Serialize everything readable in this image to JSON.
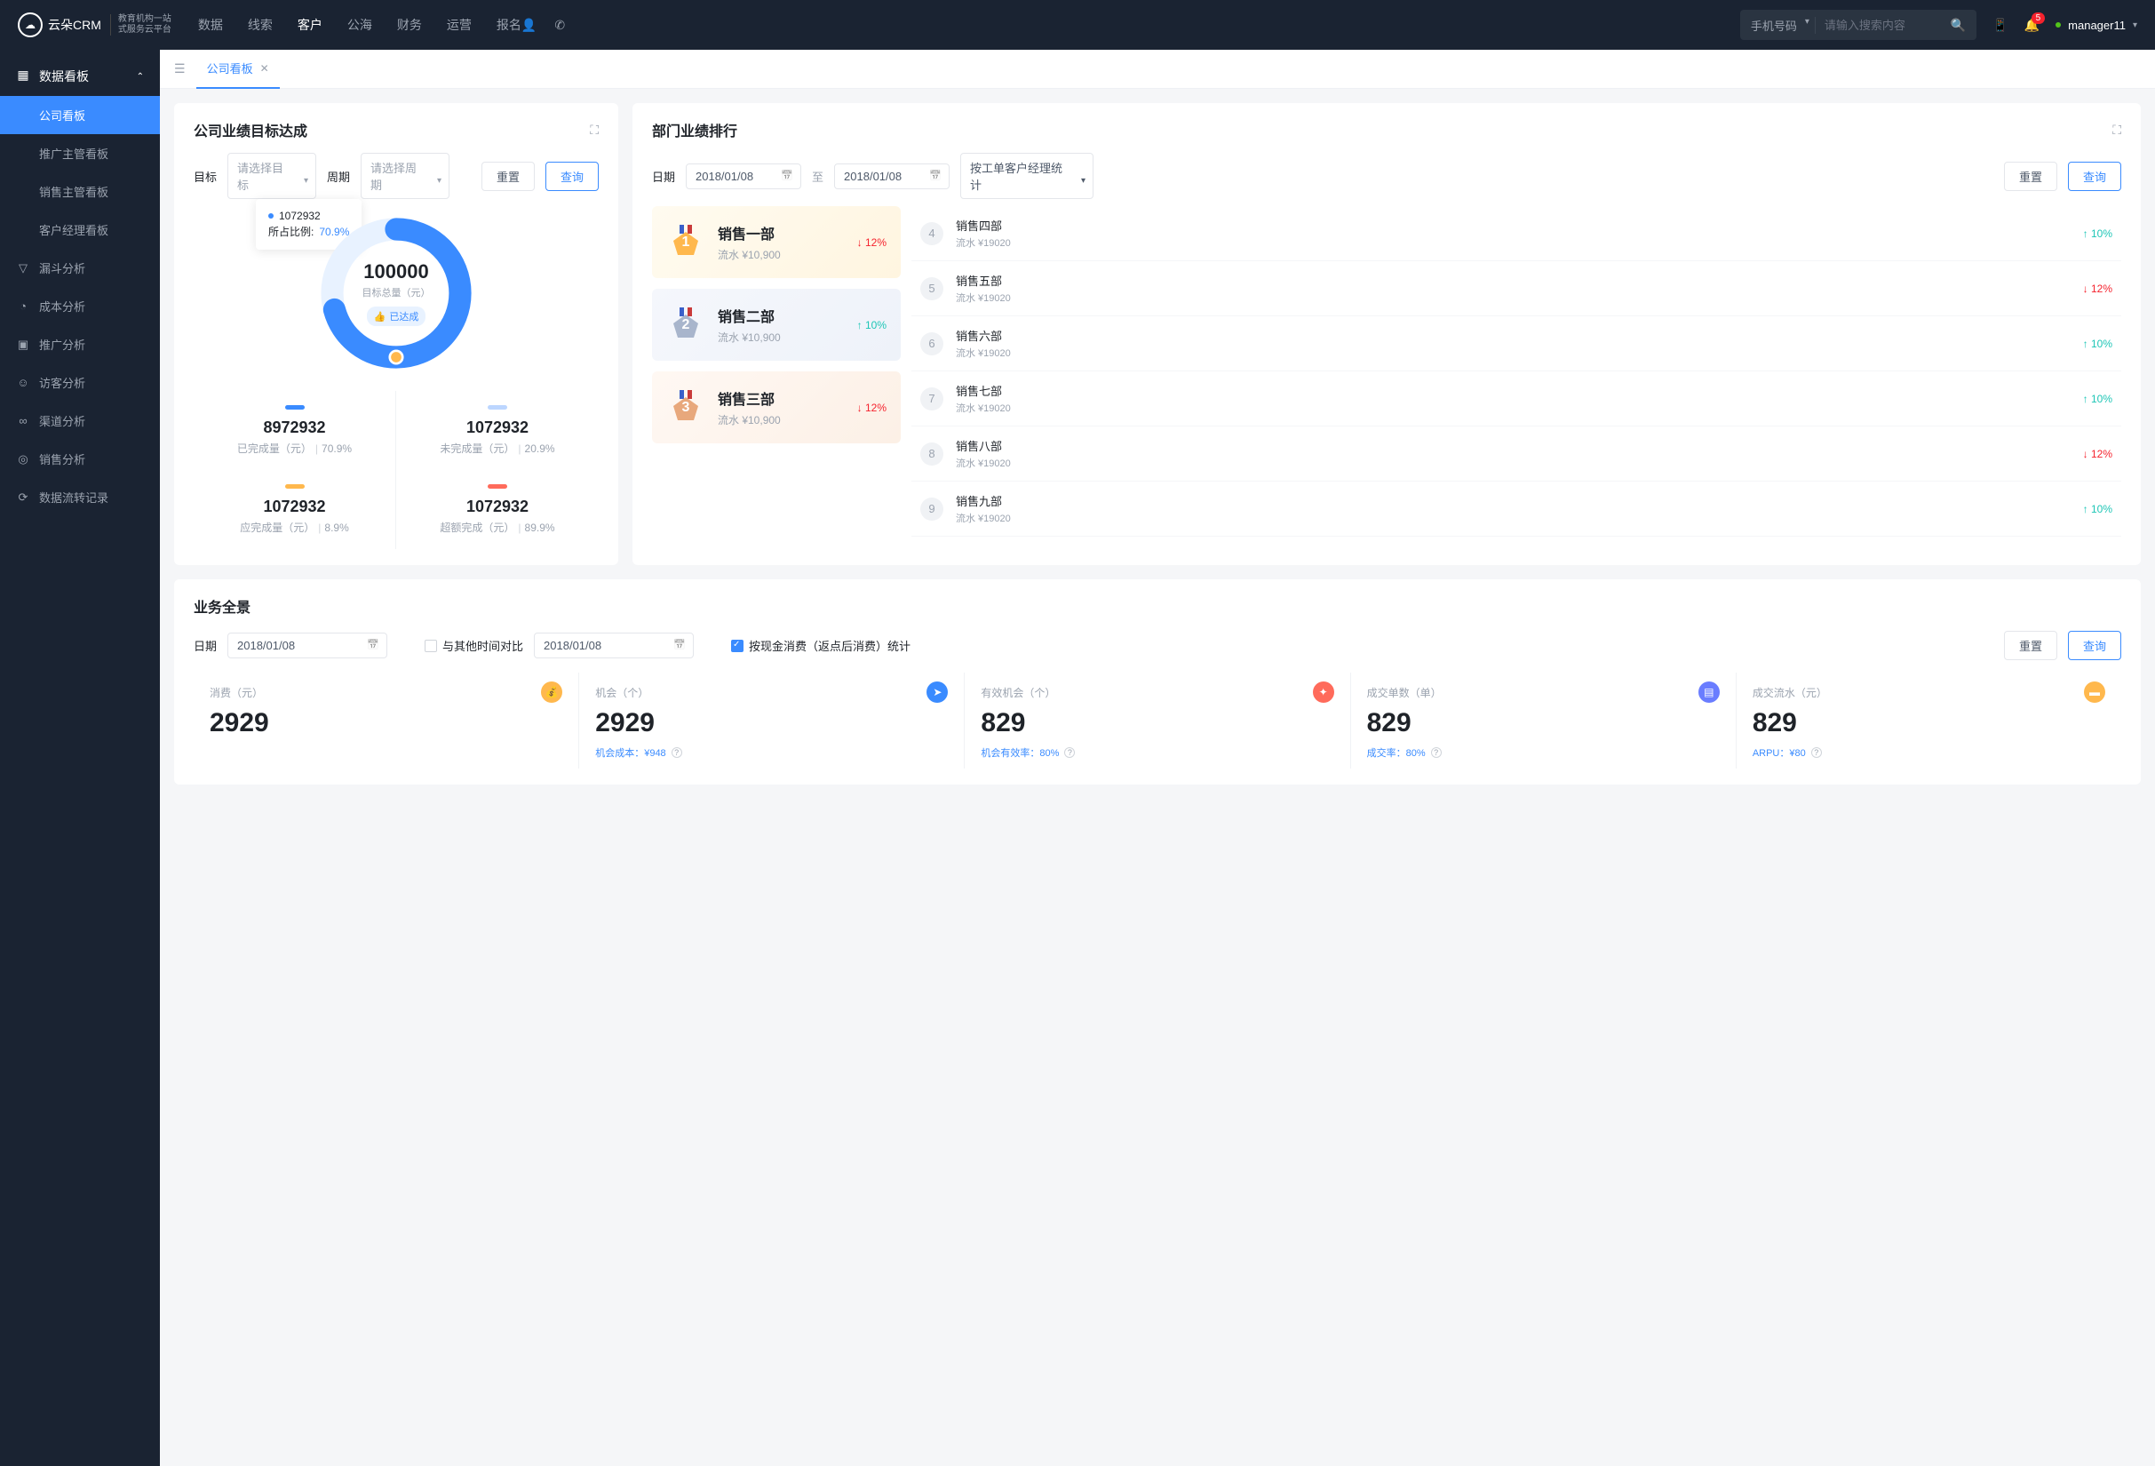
{
  "brand": {
    "name": "云朵CRM",
    "sub1": "教育机构一站",
    "sub2": "式服务云平台"
  },
  "topnav": [
    "数据",
    "线索",
    "客户",
    "公海",
    "财务",
    "运营",
    "报名"
  ],
  "topnav_active": 2,
  "search": {
    "type": "手机号码",
    "placeholder": "请输入搜索内容"
  },
  "notif_count": "5",
  "user": "manager11",
  "sidebar": {
    "head": "数据看板",
    "children": [
      "公司看板",
      "推广主管看板",
      "销售主管看板",
      "客户经理看板"
    ],
    "items": [
      "漏斗分析",
      "成本分析",
      "推广分析",
      "访客分析",
      "渠道分析",
      "销售分析",
      "数据流转记录"
    ]
  },
  "tab": "公司看板",
  "goal": {
    "title": "公司业绩目标达成",
    "target_label": "目标",
    "target_ph": "请选择目标",
    "period_label": "周期",
    "period_ph": "请选择周期",
    "reset": "重置",
    "query": "查询",
    "tooltip_val": "1072932",
    "tooltip_ratio_label": "所占比例:",
    "tooltip_ratio": "70.9%",
    "center_val": "100000",
    "center_sub": "目标总量（元）",
    "badge": "已达成",
    "stats": [
      {
        "bar": "#3a8bff",
        "val": "8972932",
        "label": "已完成量（元）",
        "pct": "70.9%"
      },
      {
        "bar": "#bcd6ff",
        "val": "1072932",
        "label": "未完成量（元）",
        "pct": "20.9%"
      },
      {
        "bar": "#ffb84d",
        "val": "1072932",
        "label": "应完成量（元）",
        "pct": "8.9%"
      },
      {
        "bar": "#ff6b5b",
        "val": "1072932",
        "label": "超额完成（元）",
        "pct": "89.9%"
      }
    ]
  },
  "rank": {
    "title": "部门业绩排行",
    "date_label": "日期",
    "date_from": "2018/01/08",
    "date_to": "2018/01/08",
    "sep": "至",
    "stat_by": "按工单客户经理统计",
    "reset": "重置",
    "query": "查询",
    "podium": [
      {
        "n": "1",
        "name": "销售一部",
        "sub": "流水 ¥10,900",
        "pct": "12%",
        "dir": "down"
      },
      {
        "n": "2",
        "name": "销售二部",
        "sub": "流水 ¥10,900",
        "pct": "10%",
        "dir": "up"
      },
      {
        "n": "3",
        "name": "销售三部",
        "sub": "流水 ¥10,900",
        "pct": "12%",
        "dir": "down"
      }
    ],
    "list": [
      {
        "n": "4",
        "name": "销售四部",
        "sub": "流水 ¥19020",
        "pct": "10%",
        "dir": "up"
      },
      {
        "n": "5",
        "name": "销售五部",
        "sub": "流水 ¥19020",
        "pct": "12%",
        "dir": "down"
      },
      {
        "n": "6",
        "name": "销售六部",
        "sub": "流水 ¥19020",
        "pct": "10%",
        "dir": "up"
      },
      {
        "n": "7",
        "name": "销售七部",
        "sub": "流水 ¥19020",
        "pct": "10%",
        "dir": "up"
      },
      {
        "n": "8",
        "name": "销售八部",
        "sub": "流水 ¥19020",
        "pct": "12%",
        "dir": "down"
      },
      {
        "n": "9",
        "name": "销售九部",
        "sub": "流水 ¥19020",
        "pct": "10%",
        "dir": "up"
      }
    ]
  },
  "biz": {
    "title": "业务全景",
    "date_label": "日期",
    "date1": "2018/01/08",
    "compare_label": "与其他时间对比",
    "date2": "2018/01/08",
    "check_label": "按现金消费（返点后消费）统计",
    "reset": "重置",
    "query": "查询",
    "kpis": [
      {
        "label": "消费（元）",
        "val": "2929",
        "ic": "💰",
        "bg": "#ffb84d",
        "sub": ""
      },
      {
        "label": "机会（个）",
        "val": "2929",
        "ic": "➤",
        "bg": "#3a8bff",
        "sub": "机会成本：¥948"
      },
      {
        "label": "有效机会（个）",
        "val": "829",
        "ic": "✦",
        "bg": "#ff6b5b",
        "sub": "机会有效率：80%"
      },
      {
        "label": "成交单数（单）",
        "val": "829",
        "ic": "▤",
        "bg": "#6a7dff",
        "sub": "成交率：80%"
      },
      {
        "label": "成交流水（元）",
        "val": "829",
        "ic": "▬",
        "bg": "#ffb84d",
        "sub": "ARPU：¥80"
      }
    ]
  },
  "chart_data": {
    "type": "pie",
    "title": "目标总量（元）",
    "total": 100000,
    "series": [
      {
        "name": "已完成",
        "value": 1072932,
        "pct": 70.9,
        "color": "#3a8bff"
      },
      {
        "name": "未完成",
        "value": 1072932,
        "pct": 29.1,
        "color": "#e8f2ff"
      }
    ]
  }
}
